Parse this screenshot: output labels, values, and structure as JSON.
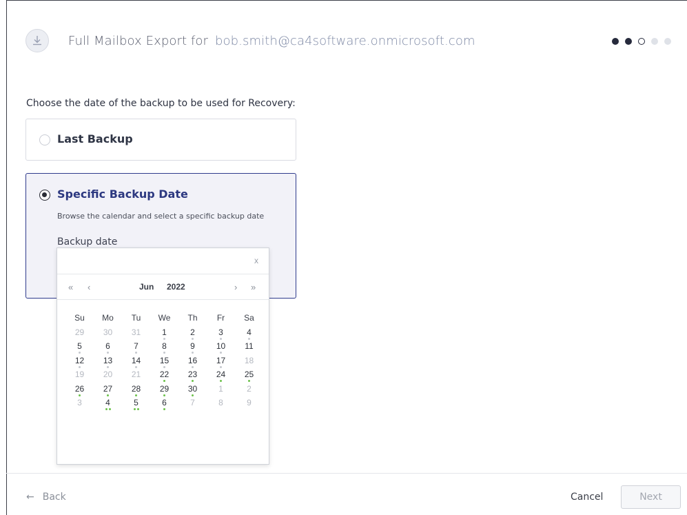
{
  "header": {
    "title": "Full Mailbox Export for",
    "email": "bob.smith@ca4software.onmicrosoft.com",
    "icon": "download-icon",
    "steps": [
      "done",
      "done",
      "current",
      "todo",
      "todo"
    ]
  },
  "prompt": "Choose the date of the backup to be used for Recovery:",
  "options": {
    "last": {
      "label": "Last Backup",
      "selected": false
    },
    "specific": {
      "label": "Specific Backup Date",
      "selected": true,
      "description": "Browse the calendar and select a specific backup date",
      "field_label": "Backup date"
    }
  },
  "calendar": {
    "close": "x",
    "nav": {
      "prev_year": "«",
      "prev_month": "‹",
      "next_month": "›",
      "next_year": "»"
    },
    "month": "Jun",
    "year": "2022",
    "weekdays": [
      "Su",
      "Mo",
      "Tu",
      "We",
      "Th",
      "Fr",
      "Sa"
    ],
    "weeks": [
      [
        {
          "d": "29",
          "m": true
        },
        {
          "d": "30",
          "m": true
        },
        {
          "d": "31",
          "m": true
        },
        {
          "d": "1",
          "g": 1
        },
        {
          "d": "2",
          "g": 1
        },
        {
          "d": "3",
          "g": 1
        },
        {
          "d": "4",
          "g": 1
        }
      ],
      [
        {
          "d": "5",
          "g": 1
        },
        {
          "d": "6",
          "g": 1
        },
        {
          "d": "7",
          "g": 1
        },
        {
          "d": "8",
          "g": 1
        },
        {
          "d": "9",
          "g": 1
        },
        {
          "d": "10",
          "g": 1
        },
        {
          "d": "11"
        }
      ],
      [
        {
          "d": "12",
          "g": 1
        },
        {
          "d": "13",
          "g": 1
        },
        {
          "d": "14",
          "g": 1
        },
        {
          "d": "15",
          "g": 1
        },
        {
          "d": "16",
          "g": 1
        },
        {
          "d": "17",
          "g": 1
        },
        {
          "d": "18",
          "m": true
        }
      ],
      [
        {
          "d": "19",
          "m": true
        },
        {
          "d": "20",
          "m": true
        },
        {
          "d": "21",
          "m": true
        },
        {
          "d": "22",
          "n": 1
        },
        {
          "d": "23",
          "n": 1
        },
        {
          "d": "24",
          "n": 1
        },
        {
          "d": "25",
          "n": 1
        }
      ],
      [
        {
          "d": "26",
          "n": 1
        },
        {
          "d": "27",
          "n": 1
        },
        {
          "d": "28",
          "n": 1
        },
        {
          "d": "29",
          "n": 1
        },
        {
          "d": "30",
          "n": 1
        },
        {
          "d": "1",
          "m": true
        },
        {
          "d": "2",
          "m": true
        }
      ],
      [
        {
          "d": "3",
          "m": true
        },
        {
          "d": "4",
          "n": 2
        },
        {
          "d": "5",
          "n": 2
        },
        {
          "d": "6",
          "n": 1
        },
        {
          "d": "7",
          "m": true
        },
        {
          "d": "8",
          "m": true
        },
        {
          "d": "9",
          "m": true
        }
      ]
    ]
  },
  "footer": {
    "back": "Back",
    "back_icon": "arrow-left-icon",
    "cancel": "Cancel",
    "next": "Next"
  },
  "colors": {
    "accent": "#2c3880",
    "green_mark": "#6cc24a",
    "grey_mark": "#c5c8ce"
  }
}
